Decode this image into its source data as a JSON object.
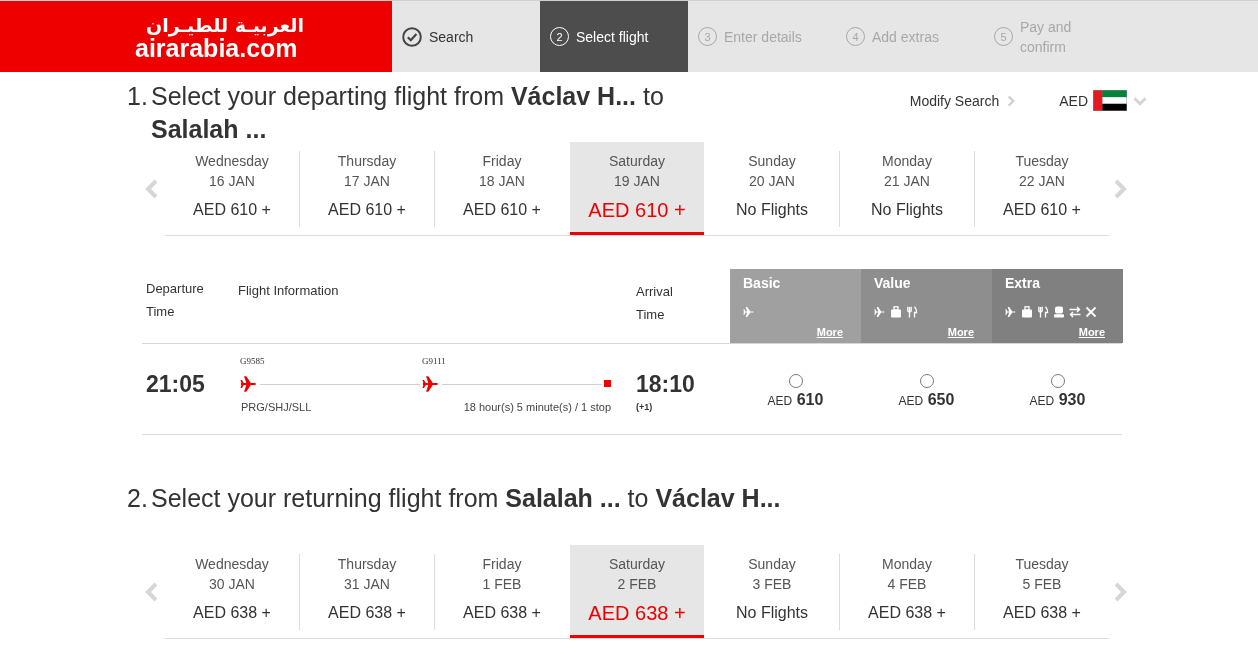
{
  "header": {
    "logo": {
      "arabic": "العربيـة للطيـران",
      "latin": "airarabia.com"
    },
    "steps": [
      {
        "label": "Search",
        "completed": true,
        "selected": false
      },
      {
        "number": "2",
        "label": "Select flight",
        "completed": false,
        "selected": true
      },
      {
        "number": "3",
        "label": "Enter details",
        "completed": false,
        "selected": false
      },
      {
        "number": "4",
        "label": "Add extras",
        "completed": false,
        "selected": false
      },
      {
        "number": "5",
        "label": "Pay and confirm",
        "completed": false,
        "selected": false
      }
    ]
  },
  "departing": {
    "number": "1.",
    "title": "Select your departing flight from **Václav H...** to **Salalah ...**",
    "modify_search": "Modify Search",
    "currency": "AED",
    "dates": [
      {
        "day": "Wednesday",
        "date": "16 JAN",
        "fare": "AED 610 +",
        "selected": false
      },
      {
        "day": "Thursday",
        "date": "17 JAN",
        "fare": "AED 610 +",
        "selected": false
      },
      {
        "day": "Friday",
        "date": "18 JAN",
        "fare": "AED 610 +",
        "selected": false
      },
      {
        "day": "Saturday",
        "date": "19 JAN",
        "fare": "AED 610 +",
        "selected": true
      },
      {
        "day": "Sunday",
        "date": "20 JAN",
        "fare": "No Flights",
        "selected": false
      },
      {
        "day": "Monday",
        "date": "21 JAN",
        "fare": "No Flights",
        "selected": false
      },
      {
        "day": "Tuesday",
        "date": "22 JAN",
        "fare": "AED 610 +",
        "selected": false
      }
    ],
    "table": {
      "columns": [
        "Departure Time",
        "Flight Information",
        "Arrival Time"
      ],
      "fares": [
        {
          "name": "Basic",
          "color": "#a0a0a0",
          "benefits": [
            {
              "kind": "flight"
            }
          ],
          "more": "More"
        },
        {
          "name": "Value",
          "color": "#8e8e8e",
          "benefits": [
            {
              "kind": "flight"
            },
            {
              "kind": "baggage"
            },
            {
              "kind": "meal"
            }
          ],
          "more": "More"
        },
        {
          "name": "Extra",
          "color": "#808080",
          "benefits": [
            {
              "kind": "flight"
            },
            {
              "kind": "baggage"
            },
            {
              "kind": "meal"
            },
            {
              "kind": "seat"
            },
            {
              "kind": "change"
            },
            {
              "kind": "cancel"
            }
          ],
          "more": "More"
        }
      ],
      "rows": [
        {
          "departure": "21:05",
          "segments": [
            {
              "flight_no": "G9585"
            },
            {
              "flight_no": "G9111"
            }
          ],
          "route": "PRG/SHJ/SLL",
          "duration": "18 hour(s) 5 minute(s) / 1 stop",
          "arrival": "18:10",
          "day_offset": "(+1)",
          "fares": [
            {
              "currency": "AED",
              "amount": "610",
              "selected": false
            },
            {
              "currency": "AED",
              "amount": "650",
              "selected": false
            },
            {
              "currency": "AED",
              "amount": "930",
              "selected": false
            }
          ]
        }
      ]
    }
  },
  "returning": {
    "number": "2.",
    "title": "Select your returning flight from **Salalah ...** to **Václav H...**",
    "dates": [
      {
        "day": "Wednesday",
        "date": "30 JAN",
        "fare": "AED 638 +",
        "selected": false
      },
      {
        "day": "Thursday",
        "date": "31 JAN",
        "fare": "AED 638 +",
        "selected": false
      },
      {
        "day": "Friday",
        "date": "1 FEB",
        "fare": "AED 638 +",
        "selected": false
      },
      {
        "day": "Saturday",
        "date": "2 FEB",
        "fare": "AED 638 +",
        "selected": true
      },
      {
        "day": "Sunday",
        "date": "3 FEB",
        "fare": "No Flights",
        "selected": false
      },
      {
        "day": "Monday",
        "date": "4 FEB",
        "fare": "AED 638 +",
        "selected": false
      },
      {
        "day": "Tuesday",
        "date": "5 FEB",
        "fare": "AED 638 +",
        "selected": false
      }
    ]
  }
}
